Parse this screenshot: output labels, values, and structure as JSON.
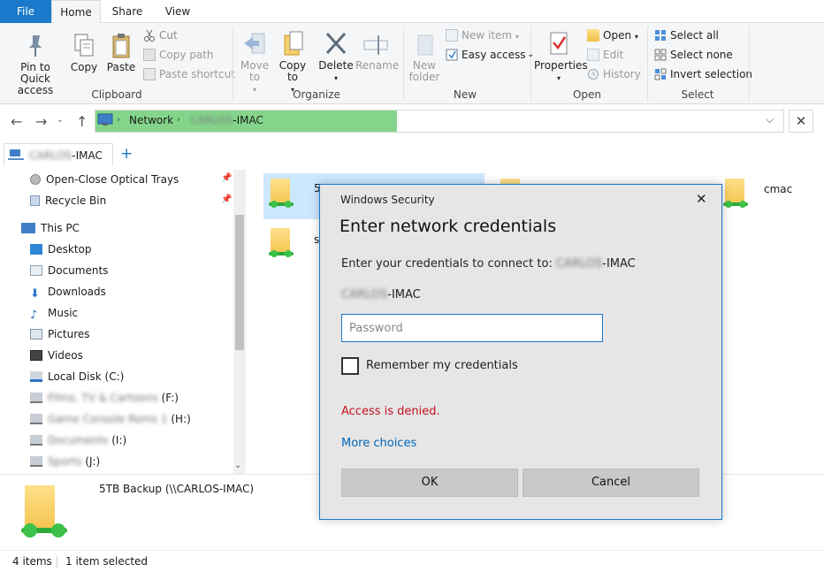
{
  "tabs": {
    "file": "File",
    "home": "Home",
    "share": "Share",
    "view": "View"
  },
  "ribbon": {
    "clipboard": {
      "label": "Clipboard",
      "pin": "Pin to Quick access",
      "copy": "Copy",
      "paste": "Paste",
      "cut": "Cut",
      "copy_path": "Copy path",
      "paste_shortcut": "Paste shortcut"
    },
    "organize": {
      "label": "Organize",
      "move_to": "Move to",
      "copy_to": "Copy to",
      "delete": "Delete",
      "rename": "Rename"
    },
    "new": {
      "label": "New",
      "new_folder": "New folder",
      "new_item": "New item",
      "easy_access": "Easy access"
    },
    "open": {
      "label": "Open",
      "properties": "Properties",
      "open": "Open",
      "edit": "Edit",
      "history": "History"
    },
    "select": {
      "label": "Select",
      "select_all": "Select all",
      "select_none": "Select none",
      "invert": "Invert selection"
    }
  },
  "address": {
    "network": "Network",
    "host_blurred": "CARLOS",
    "host_suffix": "-IMAC"
  },
  "location_tab": {
    "host_blurred": "CARLOS",
    "host_suffix": "-IMAC",
    "add": "+"
  },
  "nav": {
    "quick": [
      {
        "label": "Open-Close Optical Trays"
      },
      {
        "label": "Recycle Bin"
      }
    ],
    "this_pc": "This PC",
    "pc_items": [
      {
        "label": "Desktop"
      },
      {
        "label": "Documents"
      },
      {
        "label": "Downloads"
      },
      {
        "label": "Music"
      },
      {
        "label": "Pictures"
      },
      {
        "label": "Videos"
      },
      {
        "label": "Local Disk (C:)"
      }
    ],
    "drives": [
      {
        "blurred": "Films, TV & Cartoons",
        "suffix": "(F:)"
      },
      {
        "blurred": "Game Console Roms 1",
        "suffix": "(H:)"
      },
      {
        "blurred": "Documents",
        "suffix": "(I:)"
      },
      {
        "blurred": "Sports",
        "suffix": "(J:)"
      }
    ]
  },
  "content": {
    "items": [
      "5",
      "s",
      "cmac"
    ]
  },
  "details": {
    "name": "5TB Backup (\\\\CARLOS-IMAC)"
  },
  "status": {
    "count": "4 items",
    "selected": "1 item selected"
  },
  "dialog": {
    "window_title": "Windows Security",
    "heading": "Enter network credentials",
    "prompt": "Enter your credentials to connect to:",
    "host_blurred": "CARLOS",
    "host_suffix": "-IMAC",
    "password_placeholder": "Password",
    "remember": "Remember my credentials",
    "error": "Access is denied.",
    "more": "More choices",
    "ok": "OK",
    "cancel": "Cancel",
    "close": "✕"
  },
  "colors": {
    "accent": "#1979ca",
    "error": "#c50f1f",
    "link": "#0067b8",
    "address_highlight": "#84d58b"
  }
}
